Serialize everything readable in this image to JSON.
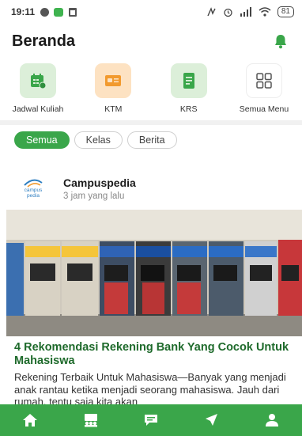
{
  "status_bar": {
    "time": "19:11",
    "battery": "81"
  },
  "header": {
    "title": "Beranda"
  },
  "menu": [
    {
      "label": "Jadwal Kuliah",
      "icon": "calendar-icon",
      "bg": "#dcefd9"
    },
    {
      "label": "KTM",
      "icon": "id-card-icon",
      "bg": "#fde2c2"
    },
    {
      "label": "KRS",
      "icon": "document-icon",
      "bg": "#dcefd9"
    },
    {
      "label": "Semua Menu",
      "icon": "grid-icon",
      "bg": "#ffffff"
    }
  ],
  "chips": [
    {
      "label": "Semua",
      "active": true
    },
    {
      "label": "Kelas",
      "active": false
    },
    {
      "label": "Berita",
      "active": false
    }
  ],
  "post": {
    "source": "Campuspedia",
    "time": "3 jam yang lalu",
    "logo_text_1": "campus",
    "logo_text_2": "pedia",
    "title": "4 Rekomendasi Rekening Bank Yang Cocok Untuk Mahasiswa",
    "excerpt": "Rekening Terbaik Untuk Mahasiswa—Banyak yang menjadi anak rantau ketika menjadi seorang mahasiswa. Jauh dari rumah, tentu saja kita akan"
  },
  "bottom_nav": [
    {
      "icon": "home-icon"
    },
    {
      "icon": "class-icon"
    },
    {
      "icon": "chat-icon"
    },
    {
      "icon": "rocket-icon"
    },
    {
      "icon": "profile-icon"
    }
  ],
  "colors": {
    "accent": "#3aa64a",
    "title_green": "#1e6a2b"
  }
}
